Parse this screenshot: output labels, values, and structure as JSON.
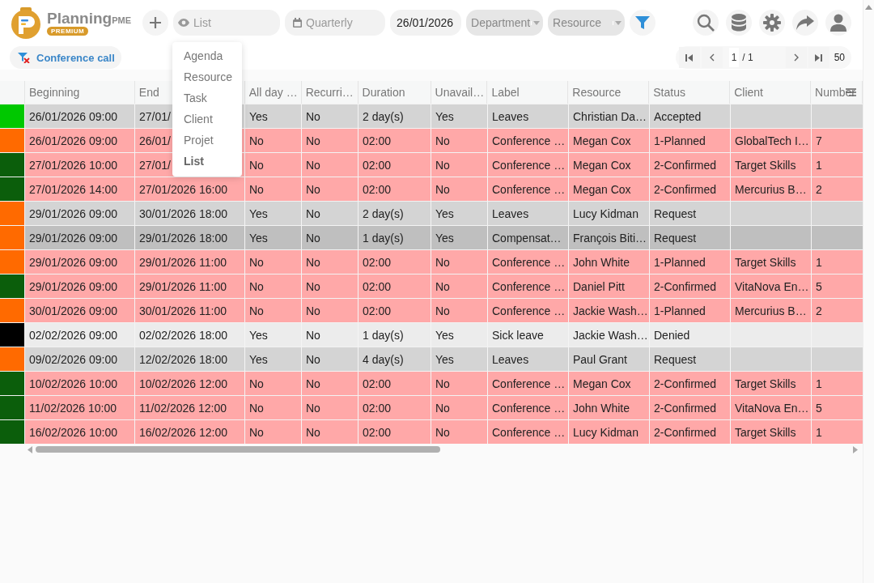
{
  "logo": {
    "name": "Planning",
    "suffix": "PME",
    "badge": "PREMIUM"
  },
  "toolbar": {
    "view_select": {
      "value": "List"
    },
    "period_select": {
      "value": "Quarterly"
    },
    "date_field": {
      "value": "26/01/2026"
    },
    "department_select": {
      "placeholder": "Department"
    },
    "resource_select": {
      "placeholder": "Resource"
    }
  },
  "view_menu": {
    "items": [
      {
        "label": "Agenda",
        "selected": false
      },
      {
        "label": "Resource",
        "selected": false
      },
      {
        "label": "Task",
        "selected": false
      },
      {
        "label": "Client",
        "selected": false
      },
      {
        "label": "Projet",
        "selected": false
      },
      {
        "label": "List",
        "selected": true
      }
    ]
  },
  "filter_chip": {
    "label": "Conference call"
  },
  "pagination": {
    "page": "1",
    "of": "/ 1",
    "page_size": "50"
  },
  "table": {
    "columns": [
      "Beginning",
      "End",
      "All day …",
      "Recurri…",
      "Duration",
      "Unavail…",
      "Label",
      "Resource",
      "Status",
      "Client",
      "Number"
    ],
    "rows": [
      {
        "color": "#00c800",
        "kind": "absence",
        "selected": false,
        "cells": [
          "26/01/2026 09:00",
          "27/01/",
          "Yes",
          "No",
          "2 day(s)",
          "Yes",
          "Leaves",
          "Christian Da…",
          "Accepted",
          "",
          ""
        ]
      },
      {
        "color": "#ff6a00",
        "kind": "meeting",
        "selected": false,
        "cells": [
          "26/01/2026 09:00",
          "26/01/",
          "No",
          "No",
          "02:00",
          "No",
          "Conference …",
          "Megan Cox",
          "1-Planned",
          "GlobalTech I…",
          "7"
        ]
      },
      {
        "color": "#0b5e0b",
        "kind": "meeting",
        "selected": false,
        "cells": [
          "27/01/2026 10:00",
          "27/01/",
          "No",
          "No",
          "02:00",
          "No",
          "Conference …",
          "Megan Cox",
          "2-Confirmed",
          "Target Skills",
          "1"
        ]
      },
      {
        "color": "#0b5e0b",
        "kind": "meeting",
        "selected": false,
        "cells": [
          "27/01/2026 14:00",
          "27/01/2026 16:00",
          "No",
          "No",
          "02:00",
          "No",
          "Conference …",
          "Megan Cox",
          "2-Confirmed",
          "Mercurius B…",
          "2"
        ]
      },
      {
        "color": "#ff6a00",
        "kind": "absence",
        "selected": false,
        "cells": [
          "29/01/2026 09:00",
          "30/01/2026 18:00",
          "Yes",
          "No",
          "2 day(s)",
          "Yes",
          "Leaves",
          "Lucy Kidman",
          "Request",
          "",
          ""
        ]
      },
      {
        "color": "#ff6a00",
        "kind": "absence",
        "selected": true,
        "cells": [
          "29/01/2026 09:00",
          "29/01/2026 18:00",
          "Yes",
          "No",
          "1 day(s)",
          "Yes",
          "Compensat…",
          "François Biti…",
          "Request",
          "",
          ""
        ]
      },
      {
        "color": "#ff6a00",
        "kind": "meeting",
        "selected": false,
        "cells": [
          "29/01/2026 09:00",
          "29/01/2026 11:00",
          "No",
          "No",
          "02:00",
          "No",
          "Conference …",
          "John White",
          "1-Planned",
          "Target Skills",
          "1"
        ]
      },
      {
        "color": "#0b5e0b",
        "kind": "meeting",
        "selected": false,
        "cells": [
          "29/01/2026 09:00",
          "29/01/2026 11:00",
          "No",
          "No",
          "02:00",
          "No",
          "Conference …",
          "Daniel Pitt",
          "2-Confirmed",
          "VitaNova En…",
          "5"
        ]
      },
      {
        "color": "#ff6a00",
        "kind": "meeting",
        "selected": false,
        "cells": [
          "30/01/2026 09:00",
          "30/01/2026 11:00",
          "No",
          "No",
          "02:00",
          "No",
          "Conference …",
          "Jackie Wash…",
          "1-Planned",
          "Mercurius B…",
          "2"
        ]
      },
      {
        "color": "#000000",
        "kind": "denied",
        "selected": false,
        "cells": [
          "02/02/2026 09:00",
          "02/02/2026 18:00",
          "Yes",
          "No",
          "1 day(s)",
          "Yes",
          "Sick leave",
          "Jackie Wash…",
          "Denied",
          "",
          ""
        ]
      },
      {
        "color": "#ff6a00",
        "kind": "absence",
        "selected": false,
        "cells": [
          "09/02/2026 09:00",
          "12/02/2026 18:00",
          "Yes",
          "No",
          "4 day(s)",
          "Yes",
          "Leaves",
          "Paul Grant",
          "Request",
          "",
          ""
        ]
      },
      {
        "color": "#0b5e0b",
        "kind": "meeting",
        "selected": false,
        "cells": [
          "10/02/2026 10:00",
          "10/02/2026 12:00",
          "No",
          "No",
          "02:00",
          "No",
          "Conference …",
          "Megan Cox",
          "2-Confirmed",
          "Target Skills",
          "1"
        ]
      },
      {
        "color": "#0b5e0b",
        "kind": "meeting",
        "selected": false,
        "cells": [
          "11/02/2026 10:00",
          "11/02/2026 12:00",
          "No",
          "No",
          "02:00",
          "No",
          "Conference …",
          "John White",
          "2-Confirmed",
          "VitaNova En…",
          "5"
        ]
      },
      {
        "color": "#0b5e0b",
        "kind": "meeting",
        "selected": false,
        "cells": [
          "16/02/2026 10:00",
          "16/02/2026 12:00",
          "No",
          "No",
          "02:00",
          "No",
          "Conference …",
          "Lucy Kidman",
          "2-Confirmed",
          "Target Skills",
          "1"
        ]
      }
    ]
  }
}
